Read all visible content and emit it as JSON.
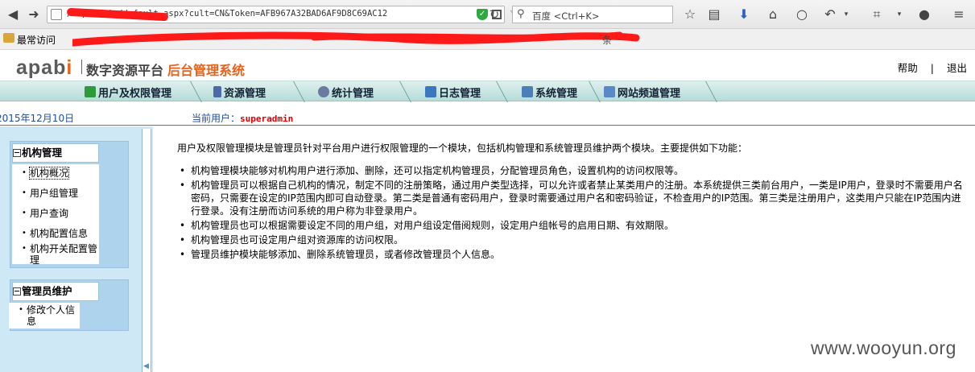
{
  "browser": {
    "url": "/Usp/admin/default.aspx?cult=CN&Token=AFB967A32BAD6AF9D8C69AC12",
    "search_placeholder": "百度 <Ctrl+K>",
    "bookmarks_label": "最常访问",
    "bookmarks_tail": "条",
    "redaction_color": "#ff1a1a"
  },
  "header": {
    "logo_text": "apabi",
    "system_name": "数字资源平台",
    "system_sub": "后台管理系统",
    "help": "帮助",
    "separator": "|",
    "logout": "退出"
  },
  "nav": {
    "items": [
      {
        "label": "用户及权限管理",
        "icon": "users-icon",
        "color": "#2e9a3c"
      },
      {
        "label": "资源管理",
        "icon": "tools-icon",
        "color": "#4a6aa8"
      },
      {
        "label": "统计管理",
        "icon": "chart-icon",
        "color": "#6a7aa0"
      },
      {
        "label": "日志管理",
        "icon": "log-icon",
        "color": "#3a78c0"
      },
      {
        "label": "系统管理",
        "icon": "monitor-icon",
        "color": "#4b7fb8"
      },
      {
        "label": "网站频道管理",
        "icon": "site-icon",
        "color": "#5a88c8"
      }
    ]
  },
  "info": {
    "date": "2015年12月10日",
    "current_user_label": "当前用户：",
    "current_user": "superadmin"
  },
  "sidebar": {
    "panels": [
      {
        "title": "机构管理",
        "items": [
          "机构概况",
          "用户组管理",
          "用户查询",
          "机构配置信息",
          "机构开关配置管理"
        ]
      },
      {
        "title": "管理员维护",
        "items": [
          "修改个人信息"
        ]
      }
    ]
  },
  "content": {
    "intro": "用户及权限管理模块是管理员针对平台用户进行权限管理的一个模块，包括机构管理和系统管理员维护两个模块。主要提供如下功能：",
    "features": [
      "机构管理模块能够对机构用户进行添加、删除，还可以指定机构管理员，分配管理员角色，设置机构的访问权限等。",
      "机构管理员可以根据自己机构的情况，制定不同的注册策略，通过用户类型选择，可以允许或者禁止某类用户的注册。本系统提供三类前台用户，一类是IP用户，登录时不需要用户名密码，只需要在设定的IP范围内即可自动登录。第二类是普通有密码用户，登录时需要通过用户名和密码验证，不检查用户的IP范围。第三类是注册用户，这类用户只能在IP范围内进行登录。没有注册而访问系统的用户称为非登录用户。",
      "机构管理员也可以根据需要设定不同的用户组，对用户组设定借阅规则，设定用户组帐号的启用日期、有效期限。",
      "机构管理员也可设定用户组对资源库的访问权限。",
      "管理员维护模块能够添加、删除系统管理员，或者修改管理员个人信息。"
    ]
  },
  "watermark": "www.wooyun.org"
}
